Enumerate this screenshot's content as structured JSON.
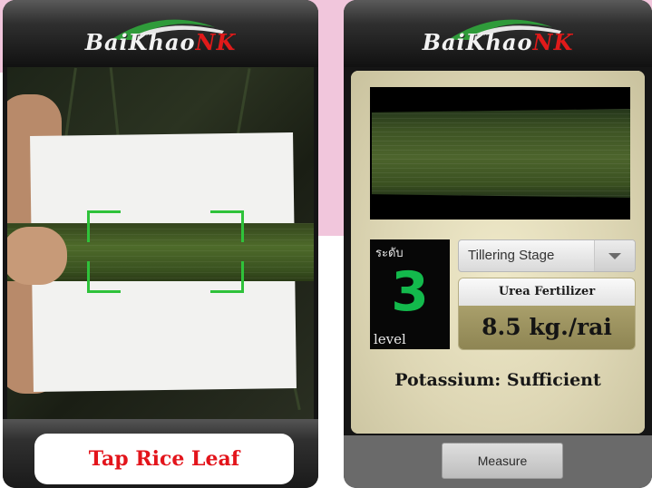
{
  "app": {
    "logo_prefix": "BaiKhao",
    "logo_suffix": "NK",
    "logo_accent_color": "#e01a1a"
  },
  "left_screen": {
    "scan_frame_color": "#2fc23a",
    "tap_button_label": "Tap Rice Leaf",
    "tap_button_color": "#e3141b"
  },
  "right_screen": {
    "level": {
      "thai_label": "ระดับ",
      "value": "3",
      "word": "level",
      "value_color": "#13b94c"
    },
    "stage_select": {
      "selected": "Tillering Stage",
      "icon": "chevron-down-icon"
    },
    "fertilizer": {
      "title": "Urea Fertilizer",
      "amount": "8.5 kg./rai"
    },
    "potassium_status": "Potassium: Sufficient",
    "measure_button_label": "Measure"
  }
}
